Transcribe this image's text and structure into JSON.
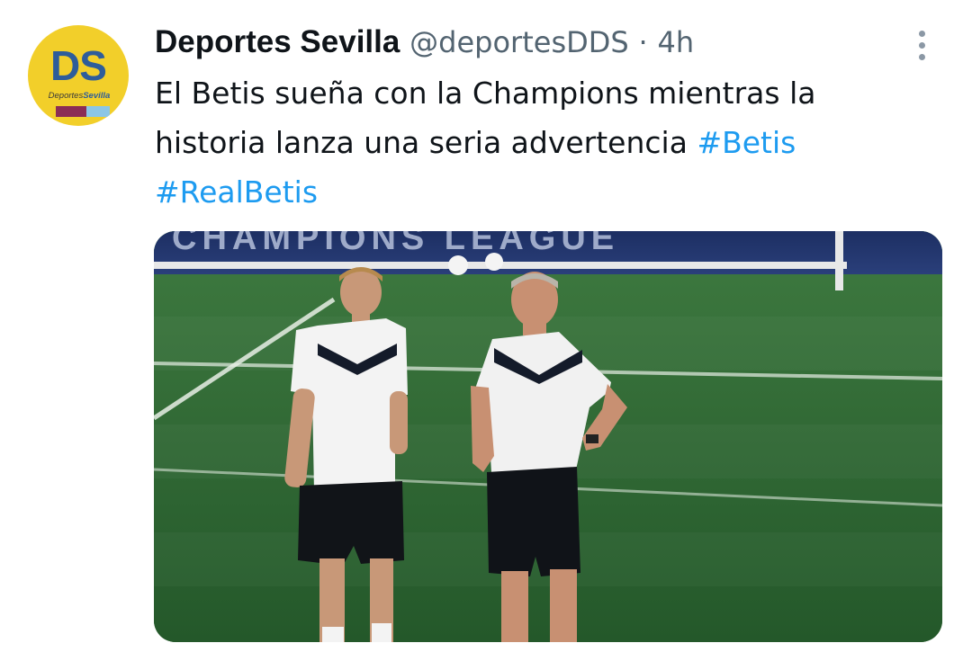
{
  "tweet": {
    "avatar": {
      "mark": "DS",
      "name_part1": "Deportes",
      "name_part2": "Sevilla",
      "icon": "deportes-sevilla-logo"
    },
    "display_name": "Deportes Sevilla",
    "handle": "@deportesDDS",
    "separator": "·",
    "time": "4h",
    "more_icon": "more-options-icon",
    "text": "El Betis sueña con la Champions mientras la historia lanza una seria advertencia ",
    "hashtags": [
      "#Betis",
      "#RealBetis"
    ],
    "media": {
      "banner_text": "CHAMPIONS LEAGUE"
    }
  },
  "colors": {
    "text": "#0f1419",
    "secondary": "#536471",
    "hashtag": "#1d9bf0",
    "pitch": "#2f6b35"
  }
}
